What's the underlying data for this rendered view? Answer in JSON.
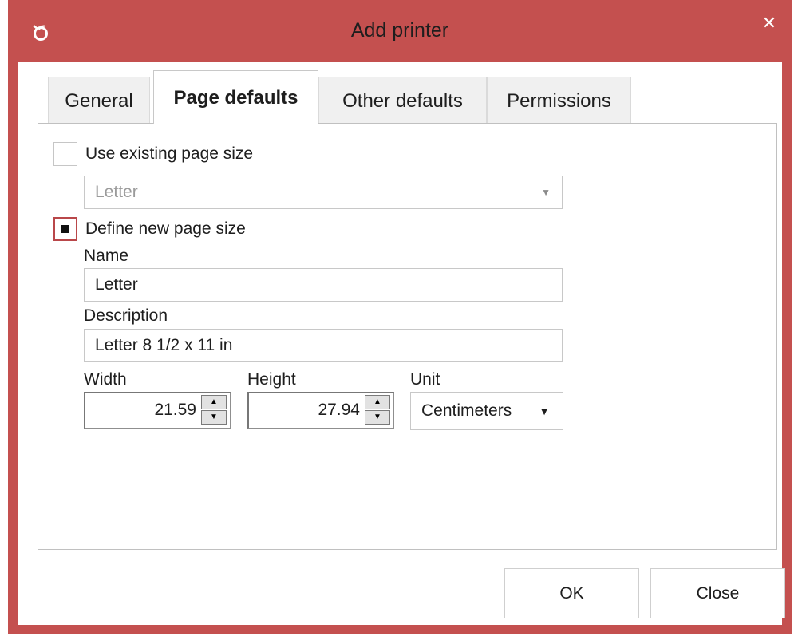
{
  "window": {
    "title": "Add printer",
    "close_glyph": "✕",
    "app_icon": "printer-app-icon",
    "colors": {
      "frame": "#c4504f",
      "accent": "#b9474a"
    }
  },
  "tabs": [
    {
      "label": "General",
      "active": false
    },
    {
      "label": "Page defaults",
      "active": true
    },
    {
      "label": "Other defaults",
      "active": false
    },
    {
      "label": "Permissions",
      "active": false
    }
  ],
  "page_size": {
    "use_existing": {
      "label": "Use existing page size",
      "checked": false,
      "selected": "Letter"
    },
    "define_new": {
      "label": "Define new page size",
      "checked": true
    },
    "name": {
      "label": "Name",
      "value": "Letter"
    },
    "description": {
      "label": "Description",
      "value": "Letter 8 1/2 x 11 in"
    },
    "width": {
      "label": "Width",
      "value": "21.59"
    },
    "height": {
      "label": "Height",
      "value": "27.94"
    },
    "unit": {
      "label": "Unit",
      "value": "Centimeters"
    }
  },
  "buttons": {
    "ok": "OK",
    "close": "Close"
  }
}
